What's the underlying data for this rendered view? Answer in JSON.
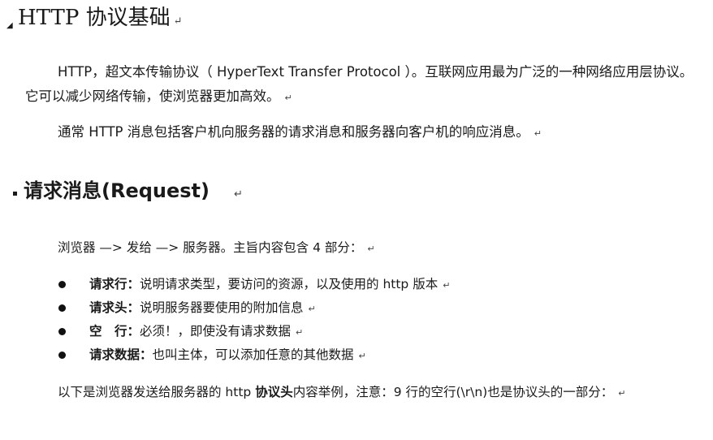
{
  "section1": {
    "heading": "HTTP 协议基础",
    "para1": "HTTP，超文本传输协议（ HyperText Transfer Protocol ）。互联网应用最为广泛的一种网络应用层协议。它可以减少网络传输，使浏览器更加高效。",
    "para2": "通常 HTTP 消息包括客户机向服务器的请求消息和服务器向客户机的响应消息。"
  },
  "section2": {
    "heading": "请求消息(Request)",
    "intro": "浏览器 —> 发给 —> 服务器。主旨内容包含 4 部分：",
    "items": [
      {
        "term": "请求行：",
        "desc": "说明请求类型，要访问的资源，以及使用的 http 版本"
      },
      {
        "term": "请求头：",
        "desc": "说明服务器要使用的附加信息"
      },
      {
        "term": "空　行：",
        "desc": "必须！，即使没有请求数据"
      },
      {
        "term": "请求数据：",
        "desc": "也叫主体，可以添加任意的其他数据"
      }
    ],
    "closing_before": "以下是浏览器发送给服务器的 http ",
    "closing_bold": "协议头",
    "closing_after": "内容举例，注意：9 行的空行(\\r\\n)也是协议头的一部分："
  },
  "paragraph_mark": "↵"
}
